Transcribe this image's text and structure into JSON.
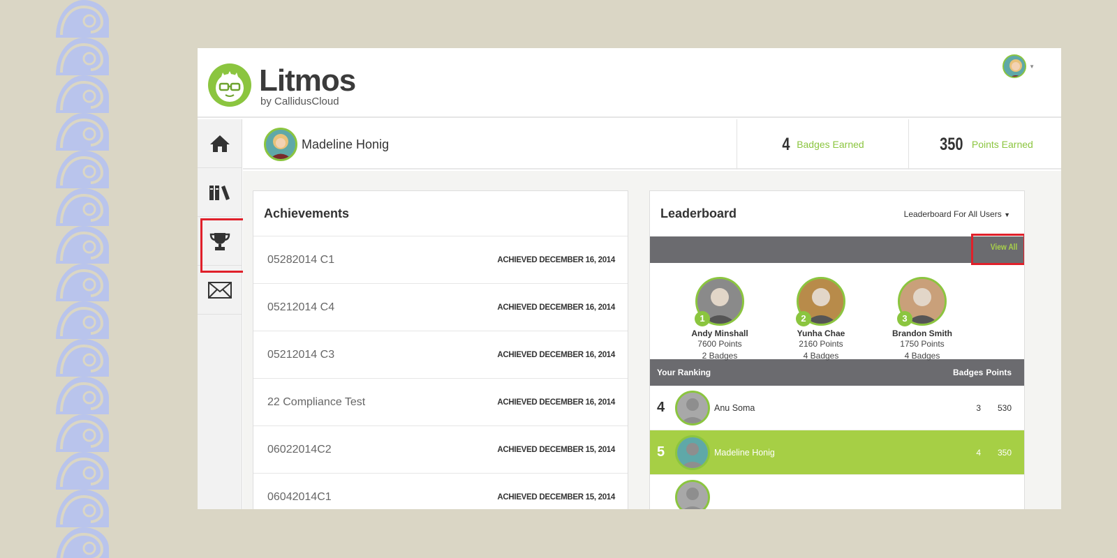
{
  "brand": {
    "name": "Litmos",
    "tagline": "by CallidusCloud"
  },
  "colors": {
    "accent": "#8bc53f",
    "highlight": "#e0202a",
    "bar": "#6b6b6f",
    "background": "#dad6c5"
  },
  "nav": [
    {
      "icon": "home-icon"
    },
    {
      "icon": "library-icon"
    },
    {
      "icon": "trophy-icon"
    },
    {
      "icon": "mail-icon"
    }
  ],
  "profile": {
    "name": "Madeline Honig",
    "badges_count": "4",
    "badges_label": "Badges Earned",
    "points_count": "350",
    "points_label": "Points Earned"
  },
  "achievements": {
    "title": "Achievements",
    "rows": [
      {
        "name": "05282014 C1",
        "date": "ACHIEVED DECEMBER 16, 2014"
      },
      {
        "name": "05212014 C4",
        "date": "ACHIEVED DECEMBER 16, 2014"
      },
      {
        "name": "05212014 C3",
        "date": "ACHIEVED DECEMBER 16, 2014"
      },
      {
        "name": "22 Compliance Test",
        "date": "ACHIEVED DECEMBER 16, 2014"
      },
      {
        "name": "06022014C2",
        "date": "ACHIEVED DECEMBER 15, 2014"
      },
      {
        "name": "06042014C1",
        "date": "ACHIEVED DECEMBER 15, 2014"
      }
    ]
  },
  "leaderboard": {
    "title": "Leaderboard",
    "filter": "Leaderboard For All Users",
    "view_all": "View All",
    "top": [
      {
        "rank": "1",
        "name": "Andy Minshall",
        "points": "7600 Points",
        "badges": "2 Badges"
      },
      {
        "rank": "2",
        "name": "Yunha Chae",
        "points": "2160 Points",
        "badges": "4 Badges"
      },
      {
        "rank": "3",
        "name": "Brandon Smith",
        "points": "1750 Points",
        "badges": "4 Badges"
      }
    ],
    "ranking_header": {
      "label": "Your Ranking",
      "badges": "Badges",
      "points": "Points"
    },
    "ranking": [
      {
        "rank": "4",
        "name": "Anu Soma",
        "badges": "3",
        "points": "530"
      },
      {
        "rank": "5",
        "name": "Madeline Honig",
        "badges": "4",
        "points": "350"
      },
      {
        "rank": "",
        "name": "",
        "badges": "",
        "points": ""
      }
    ]
  }
}
